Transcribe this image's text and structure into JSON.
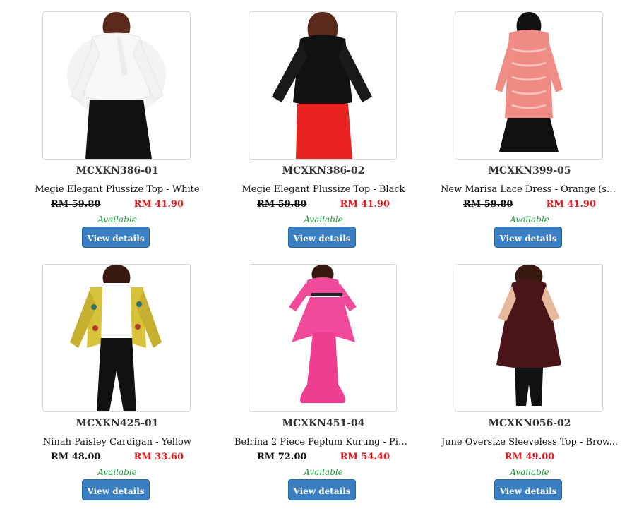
{
  "products": [
    {
      "sku": "MCXKN386-01",
      "name": "Megie Elegant Plussize Top - White",
      "old_price": "RM 59.80",
      "price": "RM 41.90",
      "availability": "Available",
      "button": "View details »",
      "colors": {
        "top": "#f7f7f7",
        "bottom": "#111111"
      }
    },
    {
      "sku": "MCXKN386-02",
      "name": "Megie Elegant Plussize Top - Black",
      "old_price": "RM 59.80",
      "price": "RM 41.90",
      "availability": "Available",
      "button": "View details »",
      "colors": {
        "top": "#111111",
        "bottom": "#e8231f"
      }
    },
    {
      "sku": "MCXKN399-05",
      "name": "New Marisa Lace Dress - Orange (siz...",
      "old_price": "RM 59.80",
      "price": "RM 41.90",
      "availability": "Available",
      "button": "View details »",
      "colors": {
        "top": "#f08a84",
        "bottom": "#111111"
      }
    },
    {
      "sku": "MCXKN425-01",
      "name": "Ninah Paisley Cardigan - Yellow",
      "old_price": "RM 48.00",
      "price": "RM 33.60",
      "availability": "Available",
      "button": "View details »",
      "colors": {
        "top": "#d8c23a",
        "bottom": "#111111"
      }
    },
    {
      "sku": "MCXKN451-04",
      "name": "Belrina 2 Piece Peplum Kurung - Pin...",
      "old_price": "RM 72.00",
      "price": "RM 54.40",
      "availability": "Available",
      "button": "View details »",
      "colors": {
        "top": "#f24a9a",
        "bottom": "#f24a9a"
      }
    },
    {
      "sku": "MCXKN056-02",
      "name": "June Oversize Sleeveless Top - Brow...",
      "old_price": "",
      "price": "RM 49.00",
      "availability": "Available",
      "button": "View details »",
      "colors": {
        "top": "#4a1418",
        "bottom": "#111111"
      }
    }
  ]
}
